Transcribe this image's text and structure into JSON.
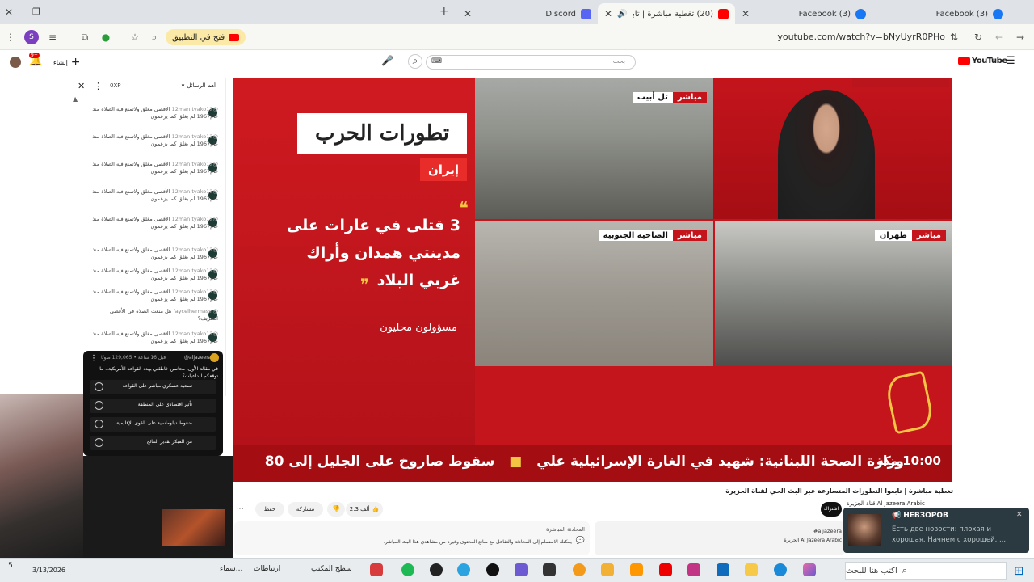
{
  "tabs": [
    {
      "title": "Discord",
      "icon": "discord-icon",
      "color": "#5865f2"
    },
    {
      "title": "(20) تغطية مباشرة | تابعوا الت",
      "icon": "youtube-icon",
      "color": "#ff0000",
      "active": true
    },
    {
      "title": "(3) Facebook",
      "icon": "facebook-icon",
      "color": "#1877f2"
    },
    {
      "title": "(3) Facebook",
      "icon": "facebook-icon",
      "color": "#1877f2"
    }
  ],
  "toolbar": {
    "url": "youtube.com/watch?v=bNyUyrR0PHo",
    "open_app_label": "فتح في التطبيق"
  },
  "youtube": {
    "logo": "YouTube",
    "search_placeholder": "بحث",
    "create_label": "إنشاء"
  },
  "chat": {
    "header_title": "أهم الرسائل",
    "header_xp": "0XP",
    "messages": [
      {
        "user": "@12man.tyako12",
        "text": "الأقصى مغلق ولاتمنع فيه الصلاة منذ عام1967 لم يغلق كما يزعمون"
      },
      {
        "user": "@12man.tyako12",
        "text": "الأقصى مغلق ولاتمنع فيه الصلاة منذ عام1967 لم يغلق كما يزعمون"
      },
      {
        "user": "@12man.tyako12",
        "text": "الأقصى مغلق ولاتمنع فيه الصلاة منذ عام1967 لم يغلق كما يزعمون"
      },
      {
        "user": "@12man.tyako12",
        "text": "الأقصى مغلق ولاتمنع فيه الصلاة منذ عام1967 لم يغلق كما يزعمون"
      },
      {
        "user": "@12man.tyako12",
        "text": "الأقصى مغلق ولاتمنع فيه الصلاة منذ عام1967 لم يغلق كما يزعمون"
      },
      {
        "user": "@12man.tyako12",
        "text": "الأقصى مغلق ولاتمنع فيه الصلاة منذ عام1967 لم يغلق كما يزعمون"
      },
      {
        "user": "@12man.tyako12",
        "text": "الأقصى مغلق ولاتمنع فيه الصلاة منذ عام1967 لم يغلق كما يزعمون"
      },
      {
        "user": "@12man.tyako12",
        "text": "الأقصى مغلق ولاتمنع فيه الصلاة منذ عام1967 لم يغلق كما يزعمون"
      },
      {
        "user": "@faycelhermassi",
        "text": "هل منعت الصلاة في الأقصى الشريف؟"
      },
      {
        "user": "@12man.tyako12",
        "text": "الأقصى مغلق ولاتمنع فيه الصلاة منذ عام1967 لم يغلق كما يزعمون"
      },
      {
        "user": "@12man.tyako12",
        "text": "الأقصى مغلق ولاتمنع فيه الصلاة منذ عام1967 لم يغلق كما يزعمون"
      }
    ]
  },
  "poll": {
    "author": "@aljazeera",
    "meta": "قبل 16 ساعة • 129,065 صوتًا",
    "question": "في مقالة الأول، محاسن خاطئتي بهدد القواعد الأمريكية.. ما توقعكم للداعيات؟",
    "options": [
      "تصعيد عسكري مباشر على القواعد",
      "تأثير اقتصادي على المنطقة",
      "ضغوط دبلوماسية على القوى الإقليمية",
      "من المبكر تقدير النتائج"
    ]
  },
  "video": {
    "headline": "تطورات الحرب",
    "region": "إيران",
    "quote": "3 قتلى في غارات على مدينتي همدان وأراك غربي البلاد",
    "source": "مسؤولون محليون",
    "feeds": [
      {
        "live": "مباشر",
        "place": "تل أبيب"
      },
      {
        "live": "مباشر",
        "place": "الضاحية الجنوبية"
      },
      {
        "live": "مباشر",
        "place": "طهران"
      }
    ],
    "ticker": "وزارة الصحة اللبنانية: شهيد في الغارة الإسرائيلية علي",
    "ticker_left": "سقوط صاروخ على الجليل إلى 80",
    "clock": "10:00 مكة"
  },
  "below_video": {
    "title": "تغطية مباشرة | تابعوا التطورات المتسارعة عبر البث الحي لقناة الجزيرة",
    "channel": "Al Jazeera Arabic قناة الجزيرة",
    "subscribe": "اشتراك",
    "likes": "2.3 ألف",
    "share": "مشاركة",
    "save": "حفظ",
    "notice_title": "المحادثة المباشرة",
    "notice_text": "يمكنك الانضمام إلى المحادثة والتفاعل مع صانع المحتوى وغيره من مشاهدي هذا البث المباشر.",
    "hashtag": "#aljazeera",
    "side_channel": "الجزيرة Al Jazeera Arabic"
  },
  "notification": {
    "sender": "НЕВЗОРОВ",
    "text": "Есть две новости: плохая и хорошая. Начнем с хорошей. ..."
  },
  "taskbar": {
    "search_placeholder": "اكتب هنا للبحث",
    "desktop_label": "سطح المكتب",
    "links_label": "ارتباطات",
    "weather": "سماء...",
    "date": "3/13/2026",
    "time": "5"
  }
}
